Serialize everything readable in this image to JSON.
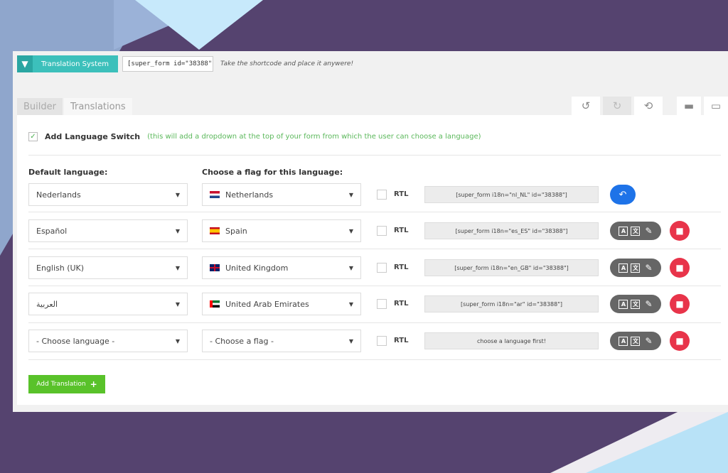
{
  "header": {
    "collapse_icon": "chevron-down-icon",
    "title": "Translation System",
    "shortcode": "[super_form id=\"38388\"",
    "hint": "Take the shortcode and place it anywere!"
  },
  "tabs": [
    {
      "label": "Builder",
      "active": false
    },
    {
      "label": "Translations",
      "active": true
    }
  ],
  "toolbar": {
    "undo": "↺",
    "redo": "↻",
    "history": "⟲",
    "minimize": "▬",
    "maximize": "▭"
  },
  "language_switch": {
    "checked": true,
    "label": "Add Language Switch",
    "note": "(this will add a dropdown at the top of your form from which the user can choose a language)"
  },
  "columns": {
    "language": "Default language:",
    "flag": "Choose a flag for this language:"
  },
  "rows": [
    {
      "language": "Nederlands",
      "flag": "Netherlands",
      "rtl": "RTL",
      "code": "[super_form i18n=\"nl_NL\" id=\"38388\"]"
    },
    {
      "language": "Español",
      "flag": "Spain",
      "rtl": "RTL",
      "code": "[super_form i18n=\"es_ES\" id=\"38388\"]"
    },
    {
      "language": "English (UK)",
      "flag": "United Kingdom",
      "rtl": "RTL",
      "code": "[super_form i18n=\"en_GB\" id=\"38388\"]"
    },
    {
      "language": "العربية",
      "flag": "United Arab Emirates",
      "rtl": "RTL",
      "code": "[super_form i18n=\"ar\" id=\"38388\"]"
    },
    {
      "language": "- Choose language -",
      "flag": "- Choose a flag -",
      "rtl": "RTL",
      "code": "choose a language first!"
    }
  ],
  "add_button": {
    "label": "Add Translation",
    "icon": "plus-icon"
  },
  "colors": {
    "teal": "#3cc0bb",
    "green": "#59c22a",
    "blue": "#1e73e8",
    "red": "#e8344a",
    "background": "#55436f"
  }
}
